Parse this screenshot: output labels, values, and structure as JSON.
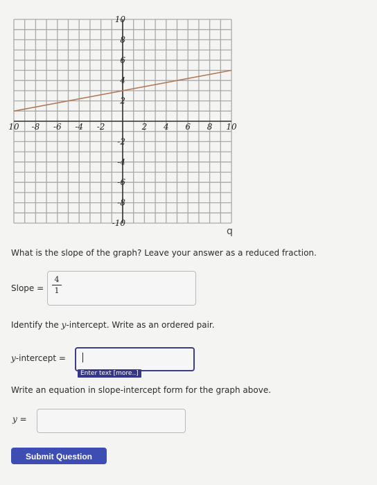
{
  "chart_data": {
    "type": "line",
    "xlim": [
      -10,
      10
    ],
    "ylim": [
      -10,
      10
    ],
    "x_ticks": [
      "10",
      "-8",
      "-6",
      "-4",
      "-2",
      "2",
      "4",
      "6",
      "8",
      "10"
    ],
    "y_ticks": [
      "10",
      "8",
      "6",
      "4",
      "2",
      "-2",
      "-4",
      "-6",
      "-8",
      "-10"
    ],
    "grid": true,
    "series": [
      {
        "x": [
          -10,
          10
        ],
        "y": [
          1,
          5
        ]
      }
    ],
    "line_color": "#b07a57"
  },
  "question1": {
    "prompt": "What is the slope of the graph? Leave your answer as a reduced fraction.",
    "label": "Slope =",
    "numerator": "4",
    "denominator": "1"
  },
  "question2": {
    "prompt": "Identify the y-intercept. Write as an ordered pair.",
    "label": "y-intercept =",
    "hint": "Enter text [more..]",
    "value": ""
  },
  "question3": {
    "prompt": "Write an equation in slope-intercept form for the graph above.",
    "label": "y =",
    "value": ""
  },
  "submit_label": "Submit Question",
  "colors": {
    "accent": "#3d4db3",
    "focus": "#3d3c8c"
  }
}
